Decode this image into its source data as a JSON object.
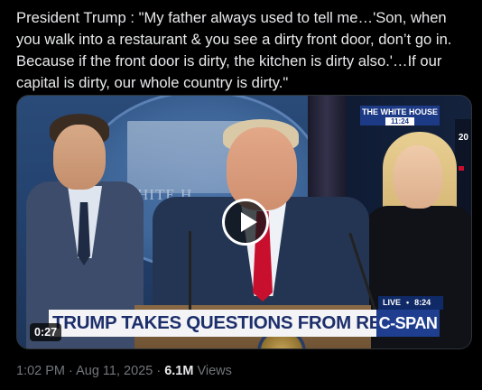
{
  "post": {
    "text": "President Trump : \"My father always used to tell me…'Son, when you walk into a restaurant & you see a dirty front door, don’t go in. Because if the front door is dirty, the kitchen is dirty also.'…If our capital is dirty, our whole country is dirty.\""
  },
  "video": {
    "background_label": "THE WHITE H",
    "badge_title": "THE WHITE HOUSE",
    "badge_time": "11:24",
    "side_text": "20",
    "live_label": "LIVE",
    "live_time": "8:24",
    "chyron": "TRUMP TAKES QUESTIONS FROM REPORTERS",
    "network": "C-SPAN",
    "duration": "0:27",
    "play_icon": "play-icon"
  },
  "meta": {
    "time": "1:02 PM",
    "separator": " · ",
    "date": "Aug 11, 2025",
    "views_count": "6.1M",
    "views_label": "Views"
  },
  "colors": {
    "background": "#000000",
    "text": "#e7e9ea",
    "muted": "#71767b",
    "chyron_text": "#1c2f6b",
    "cspan_blue": "#1f3e8f",
    "tie_red": "#c8102e"
  }
}
